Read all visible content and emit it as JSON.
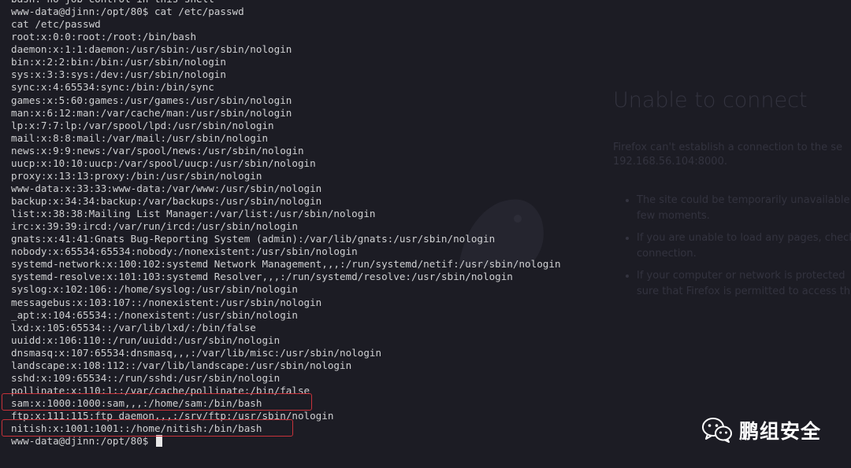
{
  "background_page": {
    "title": "Unable to connect",
    "description_lines": [
      "Firefox can't establish a connection to the se",
      "192.168.56.104:8000."
    ],
    "bullets": [
      "The site could be temporarily unavailable\nfew moments.",
      "If you are unable to load any pages, check\nconnection.",
      "If your computer or network is protected\nsure that Firefox is permitted to access th"
    ]
  },
  "terminal": {
    "lines": [
      "bash: no job control in this shell",
      "www-data@djinn:/opt/80$ cat /etc/passwd",
      "cat /etc/passwd",
      "root:x:0:0:root:/root:/bin/bash",
      "daemon:x:1:1:daemon:/usr/sbin:/usr/sbin/nologin",
      "bin:x:2:2:bin:/bin:/usr/sbin/nologin",
      "sys:x:3:3:sys:/dev:/usr/sbin/nologin",
      "sync:x:4:65534:sync:/bin:/bin/sync",
      "games:x:5:60:games:/usr/games:/usr/sbin/nologin",
      "man:x:6:12:man:/var/cache/man:/usr/sbin/nologin",
      "lp:x:7:7:lp:/var/spool/lpd:/usr/sbin/nologin",
      "mail:x:8:8:mail:/var/mail:/usr/sbin/nologin",
      "news:x:9:9:news:/var/spool/news:/usr/sbin/nologin",
      "uucp:x:10:10:uucp:/var/spool/uucp:/usr/sbin/nologin",
      "proxy:x:13:13:proxy:/bin:/usr/sbin/nologin",
      "www-data:x:33:33:www-data:/var/www:/usr/sbin/nologin",
      "backup:x:34:34:backup:/var/backups:/usr/sbin/nologin",
      "list:x:38:38:Mailing List Manager:/var/list:/usr/sbin/nologin",
      "irc:x:39:39:ircd:/var/run/ircd:/usr/sbin/nologin",
      "gnats:x:41:41:Gnats Bug-Reporting System (admin):/var/lib/gnats:/usr/sbin/nologin",
      "nobody:x:65534:65534:nobody:/nonexistent:/usr/sbin/nologin",
      "systemd-network:x:100:102:systemd Network Management,,,:/run/systemd/netif:/usr/sbin/nologin",
      "systemd-resolve:x:101:103:systemd Resolver,,,:/run/systemd/resolve:/usr/sbin/nologin",
      "syslog:x:102:106::/home/syslog:/usr/sbin/nologin",
      "messagebus:x:103:107::/nonexistent:/usr/sbin/nologin",
      "_apt:x:104:65534::/nonexistent:/usr/sbin/nologin",
      "lxd:x:105:65534::/var/lib/lxd/:/bin/false",
      "uuidd:x:106:110::/run/uuidd:/usr/sbin/nologin",
      "dnsmasq:x:107:65534:dnsmasq,,,:/var/lib/misc:/usr/sbin/nologin",
      "landscape:x:108:112::/var/lib/landscape:/usr/sbin/nologin",
      "sshd:x:109:65534::/run/sshd:/usr/sbin/nologin",
      "pollinate:x:110:1::/var/cache/pollinate:/bin/false",
      "sam:x:1000:1000:sam,,,:/home/sam:/bin/bash",
      "ftp:x:111:115:ftp daemon,,,:/srv/ftp:/usr/sbin/nologin",
      "nitish:x:1001:1001::/home/nitish:/bin/bash"
    ],
    "prompt": "www-data@djinn:/opt/80$ "
  },
  "watermark": {
    "text": "鹏组安全",
    "icon": "wechat-icon"
  },
  "colors": {
    "highlight": "#c8323a",
    "text": "#cfd0d2",
    "background": "#1c1c24"
  }
}
